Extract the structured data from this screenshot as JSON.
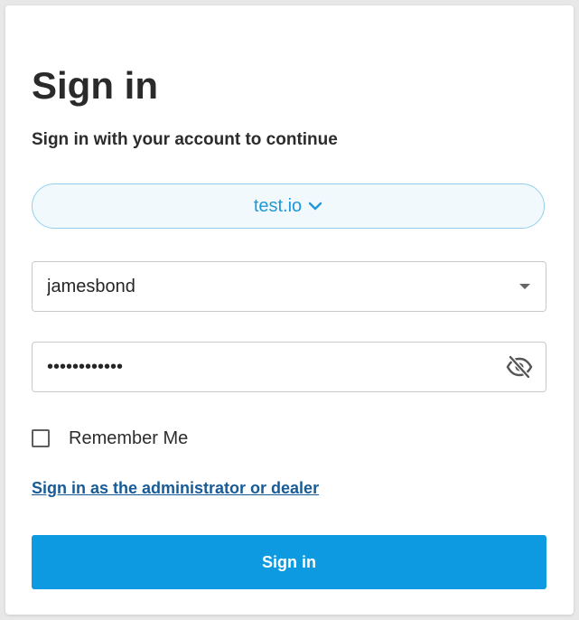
{
  "header": {
    "title": "Sign in",
    "subtitle": "Sign in with your account to continue"
  },
  "tenant": {
    "label": "test.io",
    "icon": "chevron-down-icon"
  },
  "username": {
    "value": "jamesbond",
    "icon": "dropdown-arrow-icon"
  },
  "password": {
    "value": "••••••••••••",
    "icon": "eye-off-icon"
  },
  "remember": {
    "label": "Remember Me",
    "checked": false
  },
  "admin_link": {
    "label": "Sign in as the administrator or dealer"
  },
  "submit": {
    "label": "Sign in"
  },
  "colors": {
    "primary": "#0d9ae1",
    "tenant_text": "#1f98d7",
    "tenant_bg": "#f1f9fd",
    "link": "#175b97"
  }
}
